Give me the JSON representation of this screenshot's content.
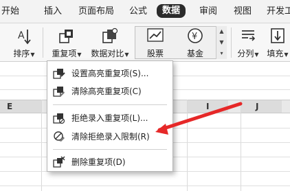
{
  "tabs": [
    {
      "label": "开始",
      "active": false
    },
    {
      "label": "插入",
      "active": false
    },
    {
      "label": "页面布局",
      "active": false
    },
    {
      "label": "公式",
      "active": false
    },
    {
      "label": "数据",
      "active": true
    },
    {
      "label": "审阅",
      "active": false
    },
    {
      "label": "视图",
      "active": false
    },
    {
      "label": "开发工",
      "active": false
    }
  ],
  "ribbon": {
    "sort": {
      "label": "排序",
      "icon": "sort-icon"
    },
    "duplicates": {
      "label": "重复项",
      "icon": "duplicates-icon"
    },
    "compare": {
      "label": "数据对比",
      "icon": "data-compare-icon"
    },
    "stocks": {
      "label": "股票",
      "icon": "stock-chart-icon"
    },
    "fund": {
      "label": "基金",
      "icon": "fund-yen-icon"
    },
    "split": {
      "label": "分列",
      "icon": "split-column-icon"
    },
    "fill": {
      "label": "填充",
      "icon": "fill-down-icon"
    }
  },
  "columns": [
    "E",
    "I",
    "J"
  ],
  "menu": {
    "items": [
      {
        "label": "设置高亮重复项(S)...",
        "icon": "highlight-duplicates-icon"
      },
      {
        "label": "清除高亮重复项(C)",
        "icon": "clear-highlight-icon"
      },
      {
        "label": "拒绝录入重复项(L)...",
        "icon": "reject-duplicates-icon"
      },
      {
        "label": "清除拒绝录入限制(R)",
        "icon": "clear-restriction-icon"
      },
      {
        "label": "删除重复项(D)",
        "icon": "delete-duplicates-icon"
      }
    ]
  },
  "colors": {
    "annotation_arrow": "#e62828",
    "active_tab_bg": "#2b2b2b",
    "menu_border": "#b5b5b5"
  }
}
